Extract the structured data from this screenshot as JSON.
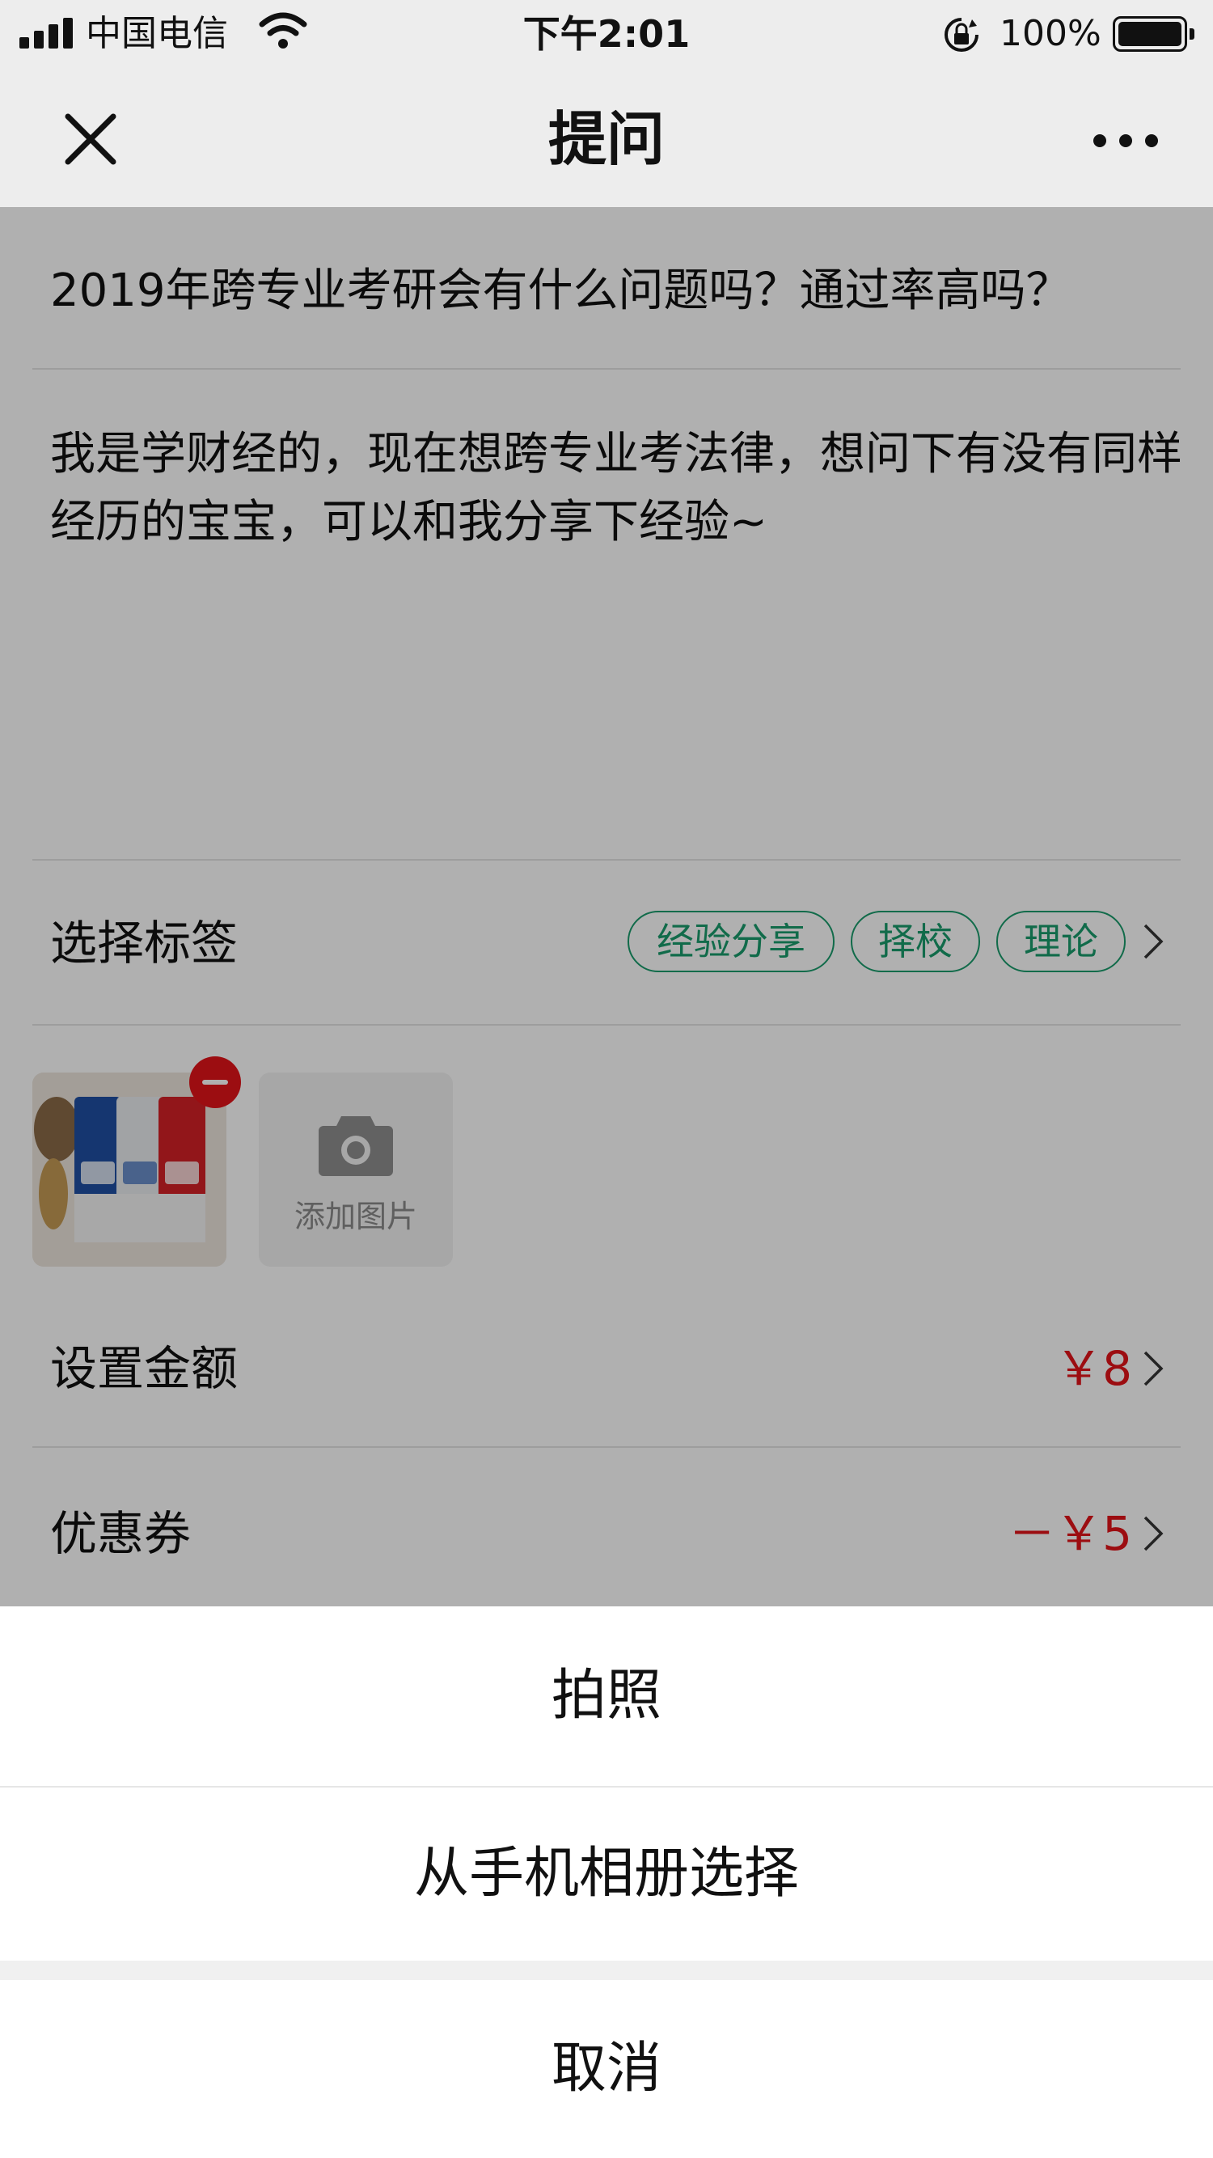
{
  "status_bar": {
    "carrier": "中国电信",
    "time": "下午2:01",
    "battery_percent": "100%"
  },
  "nav": {
    "title": "提问",
    "close_icon": "close-icon",
    "more_icon": "more-icon"
  },
  "question": {
    "title": "2019年跨专业考研会有什么问题吗？通过率高吗？",
    "body": "我是学财经的，现在想跨专业考法律，想问下有没有同样经历的宝宝，可以和我分享下经验~"
  },
  "tags": {
    "label": "选择标签",
    "items": [
      "经验分享",
      "择校",
      "理论"
    ]
  },
  "images": {
    "add_label": "添加图片"
  },
  "amount": {
    "label": "设置金额",
    "value": "￥8"
  },
  "coupon": {
    "label": "优惠券",
    "value": "－￥5"
  },
  "action_sheet": {
    "take_photo": "拍照",
    "choose_album": "从手机相册选择",
    "cancel": "取消"
  },
  "colors": {
    "accent_red": "#e2141a",
    "tag_green": "#1a9c6c"
  }
}
